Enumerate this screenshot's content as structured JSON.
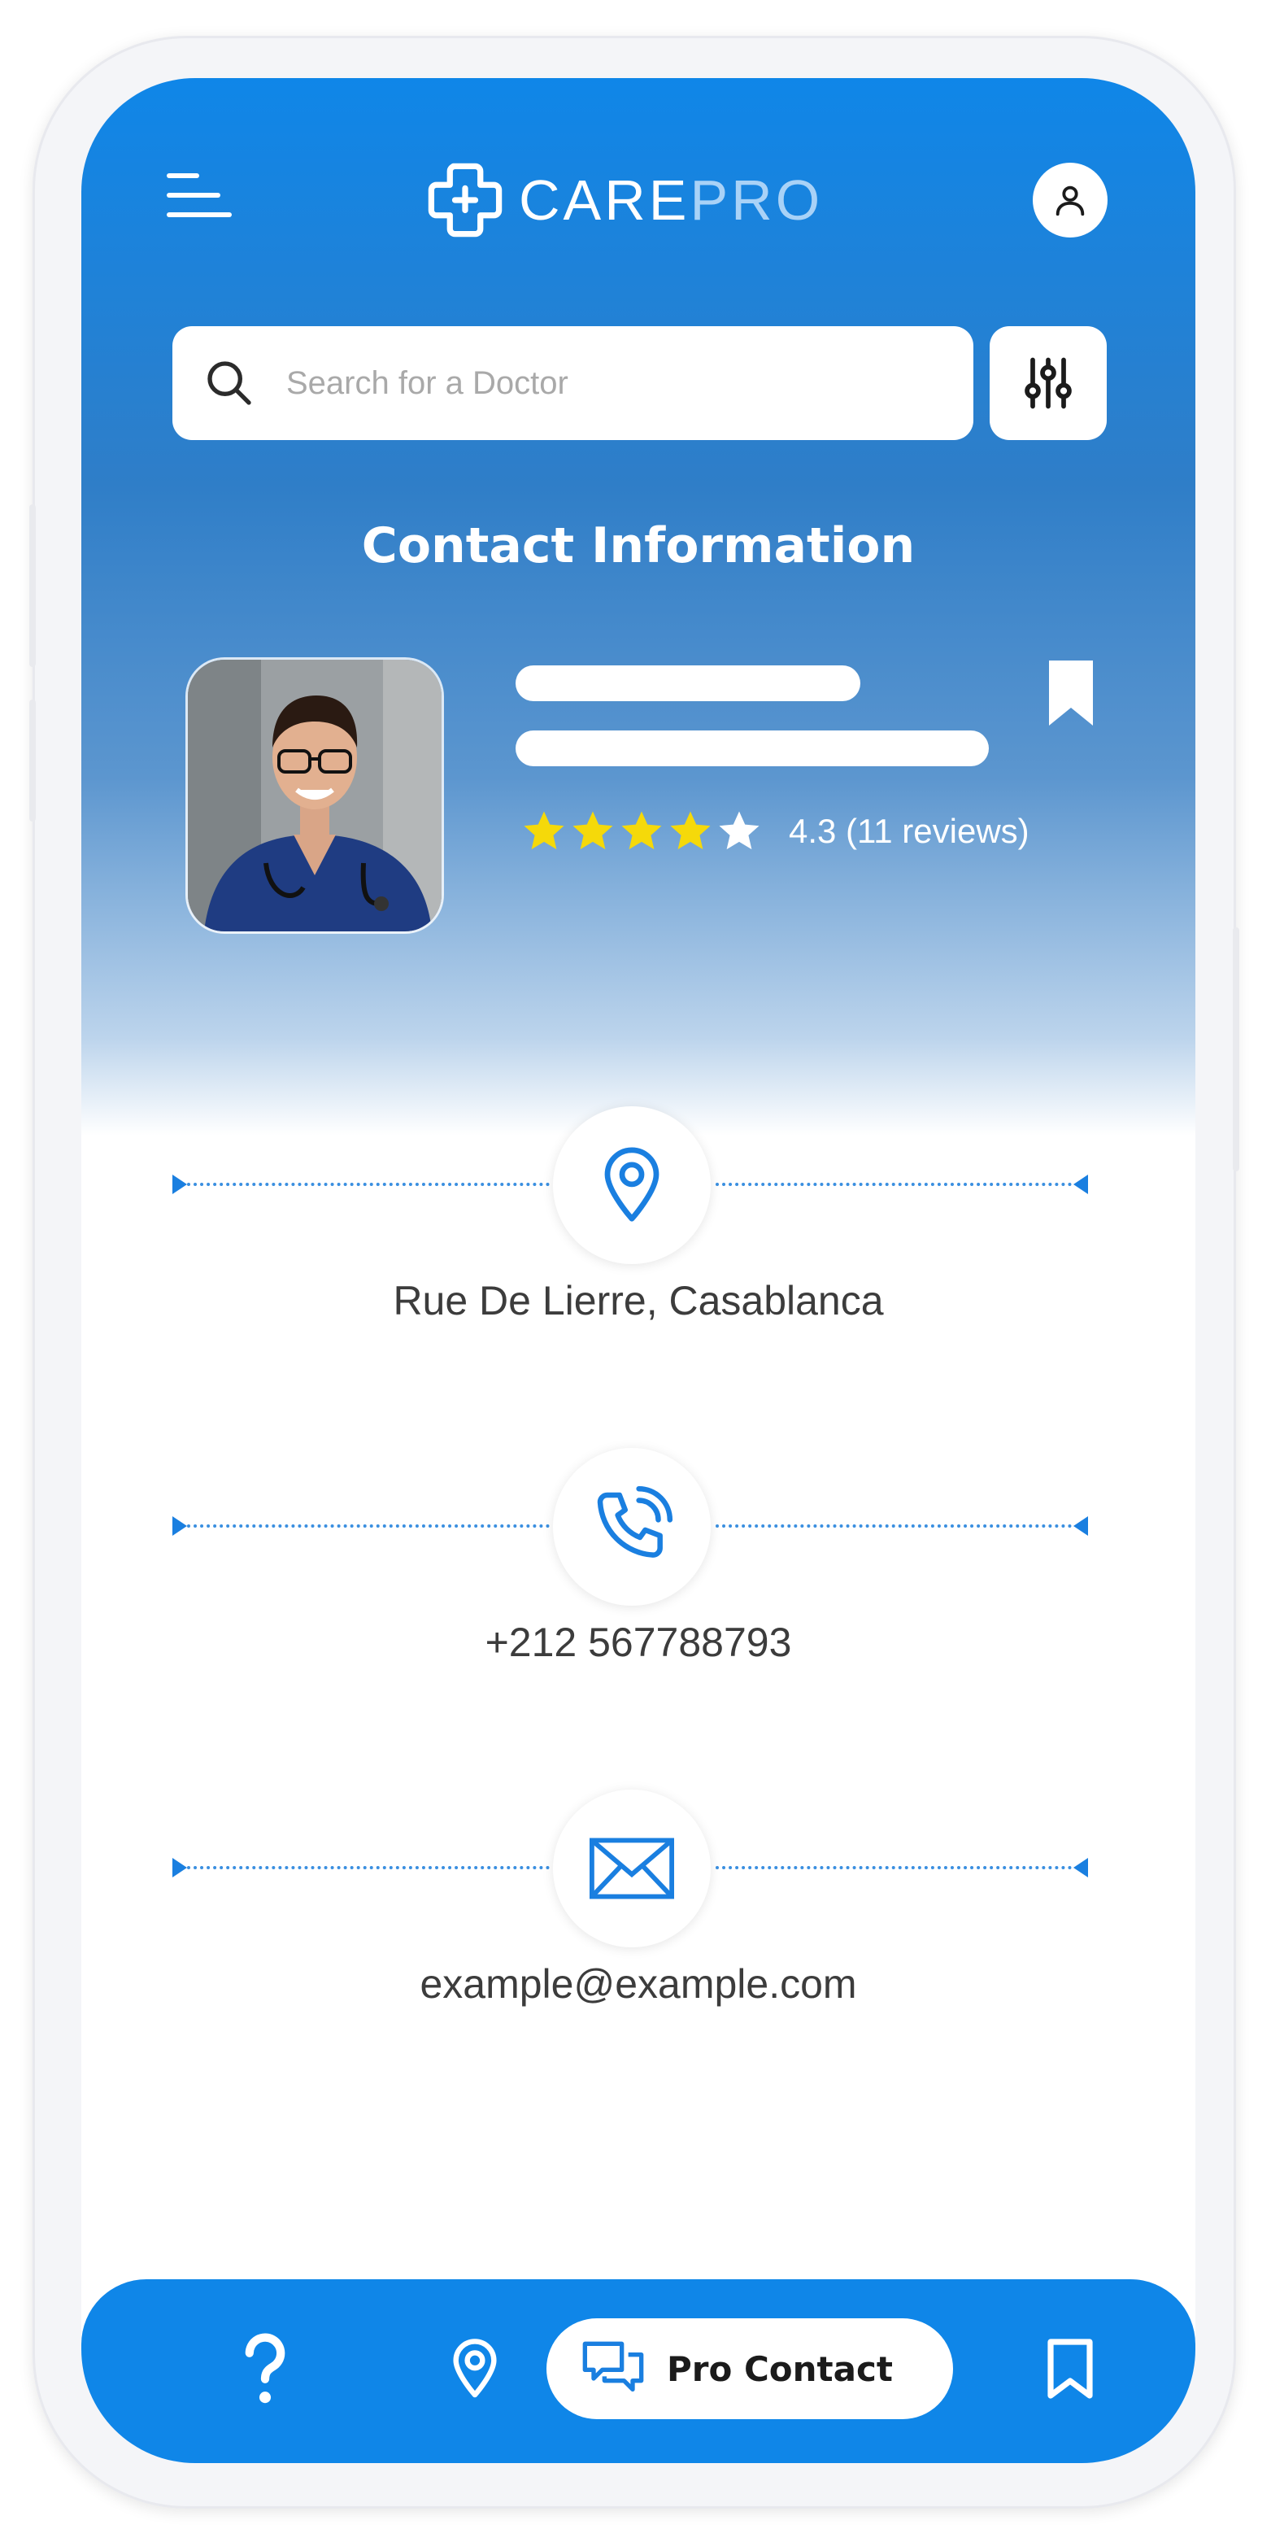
{
  "header": {
    "brand_primary": "CARE",
    "brand_secondary": "PRO",
    "menu_icon": "hamburger-menu-icon",
    "profile_icon": "user-icon"
  },
  "search": {
    "placeholder": "Search for a Doctor",
    "value": "",
    "icon": "search-icon",
    "filter_icon": "sliders-icon"
  },
  "page": {
    "title": "Contact Information"
  },
  "doctor": {
    "rating_stars": 4.3,
    "rating_text": "4.3 (11 reviews)"
  },
  "contacts": [
    {
      "icon": "location-pin-icon",
      "text": "Rue De Lierre, Casablanca"
    },
    {
      "icon": "phone-icon",
      "text": "+212 567788793"
    },
    {
      "icon": "mail-icon",
      "text": "example@example.com"
    }
  ],
  "bottom_nav": {
    "items": [
      {
        "icon": "help-icon"
      },
      {
        "icon": "location-pin-icon"
      },
      {
        "icon": "chat-icon",
        "label": "Pro Contact",
        "active": true
      },
      {
        "icon": "bookmark-icon"
      }
    ]
  },
  "colors": {
    "brand_blue": "#0f86e8",
    "star_yellow": "#f5d90a",
    "text_dark": "#3c3c3c"
  }
}
